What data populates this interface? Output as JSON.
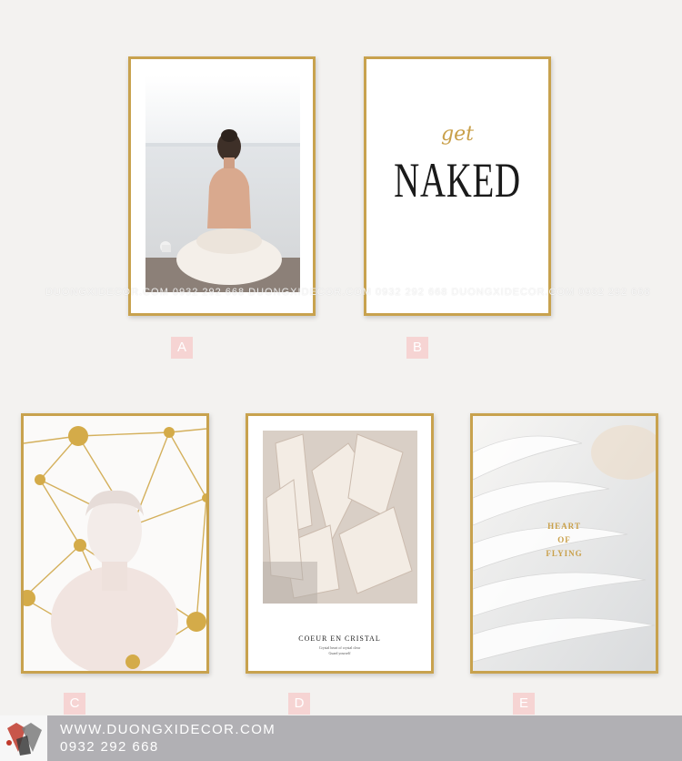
{
  "products": [
    {
      "label": "A",
      "image": "woman-seated-by-sea-photo"
    },
    {
      "label": "B",
      "image": "typography-poster",
      "script_text": "get",
      "headline": "NAKED"
    },
    {
      "label": "C",
      "image": "greek-statue-with-gold-geometric-lines"
    },
    {
      "label": "D",
      "image": "crystal-photo-poster",
      "caption_title": "COEUR EN CRISTAL",
      "caption_line1": "Crystal heart of crystal clear",
      "caption_line2": "Guard yourself"
    },
    {
      "label": "E",
      "image": "white-feather-wings",
      "text_lines": [
        "HEART",
        "OF",
        "FLYING"
      ]
    }
  ],
  "watermark": "DUONGXIDECOR.COM  0932 292 668  DUONGXIDECOR.COM  0932 292 668  DUONGXIDECOR.COM  0932 292 668",
  "footer": {
    "website": "WWW.DUONGXIDECOR.COM",
    "phone": "0932 292 668",
    "logo_icon": "brand-diamond-logo"
  },
  "colors": {
    "frame_gold": "#c8a24e",
    "label_pink": "#f6d4d3",
    "footer_gray": "#b1b0b4",
    "gold_text": "#c9a04a"
  }
}
